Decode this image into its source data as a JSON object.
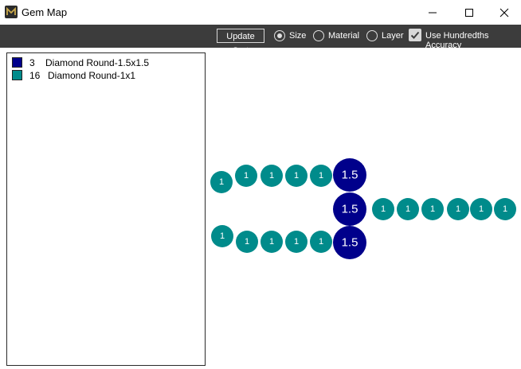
{
  "window": {
    "title": "Gem Map"
  },
  "toolbar": {
    "update_label": "Update Sort",
    "options": [
      {
        "label": "Size",
        "selected": true
      },
      {
        "label": "Material",
        "selected": false
      },
      {
        "label": "Layer",
        "selected": false
      }
    ],
    "hundredths_label": "Use Hundredths Accuracy",
    "hundredths_checked": true
  },
  "legend": [
    {
      "count": "3",
      "name": "Diamond Round-1.5x1.5",
      "color": "#00008b"
    },
    {
      "count": "16",
      "name": "Diamond Round-1x1",
      "color": "#008b8b"
    }
  ],
  "colors": {
    "large_gem": "#00008b",
    "small_gem": "#008b8b",
    "toolbar_bg": "#3c3c3c"
  },
  "gems": [
    {
      "label": "1",
      "size": 1
    },
    {
      "label": "1",
      "size": 1
    },
    {
      "label": "1",
      "size": 1
    },
    {
      "label": "1",
      "size": 1
    },
    {
      "label": "1",
      "size": 1
    },
    {
      "label": "1.5",
      "size": 1.5
    },
    {
      "label": "1.5",
      "size": 1.5
    },
    {
      "label": "1",
      "size": 1
    },
    {
      "label": "1",
      "size": 1
    },
    {
      "label": "1",
      "size": 1
    },
    {
      "label": "1",
      "size": 1
    },
    {
      "label": "1",
      "size": 1
    },
    {
      "label": "1",
      "size": 1
    },
    {
      "label": "1",
      "size": 1
    },
    {
      "label": "1",
      "size": 1
    },
    {
      "label": "1",
      "size": 1
    },
    {
      "label": "1",
      "size": 1
    },
    {
      "label": "1",
      "size": 1
    },
    {
      "label": "1.5",
      "size": 1.5
    }
  ]
}
